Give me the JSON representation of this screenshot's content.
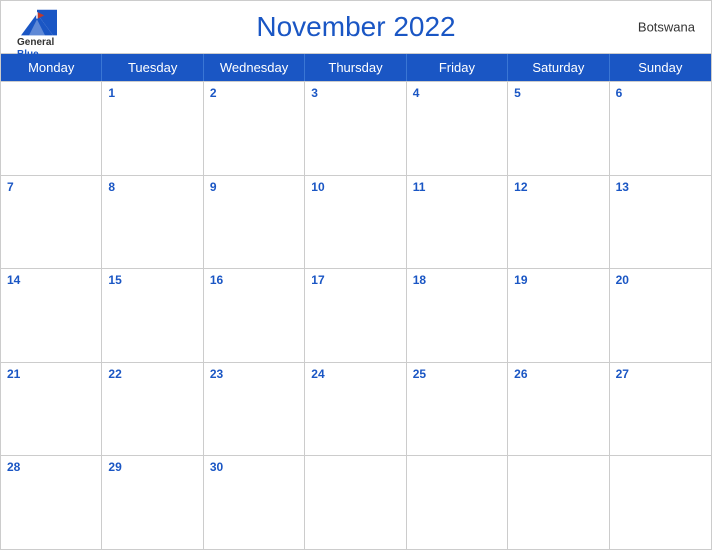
{
  "header": {
    "title": "November 2022",
    "country": "Botswana",
    "logo": {
      "line1": "General",
      "line2": "Blue"
    }
  },
  "dayHeaders": [
    "Monday",
    "Tuesday",
    "Wednesday",
    "Thursday",
    "Friday",
    "Saturday",
    "Sunday"
  ],
  "weeks": [
    [
      {
        "num": "",
        "empty": true
      },
      {
        "num": "1"
      },
      {
        "num": "2"
      },
      {
        "num": "3"
      },
      {
        "num": "4"
      },
      {
        "num": "5"
      },
      {
        "num": "6"
      }
    ],
    [
      {
        "num": "7"
      },
      {
        "num": "8"
      },
      {
        "num": "9"
      },
      {
        "num": "10"
      },
      {
        "num": "11"
      },
      {
        "num": "12"
      },
      {
        "num": "13"
      }
    ],
    [
      {
        "num": "14"
      },
      {
        "num": "15"
      },
      {
        "num": "16"
      },
      {
        "num": "17"
      },
      {
        "num": "18"
      },
      {
        "num": "19"
      },
      {
        "num": "20"
      }
    ],
    [
      {
        "num": "21"
      },
      {
        "num": "22"
      },
      {
        "num": "23"
      },
      {
        "num": "24"
      },
      {
        "num": "25"
      },
      {
        "num": "26"
      },
      {
        "num": "27"
      }
    ],
    [
      {
        "num": "28"
      },
      {
        "num": "29"
      },
      {
        "num": "30"
      },
      {
        "num": "",
        "empty": true
      },
      {
        "num": "",
        "empty": true
      },
      {
        "num": "",
        "empty": true
      },
      {
        "num": "",
        "empty": true
      }
    ]
  ]
}
